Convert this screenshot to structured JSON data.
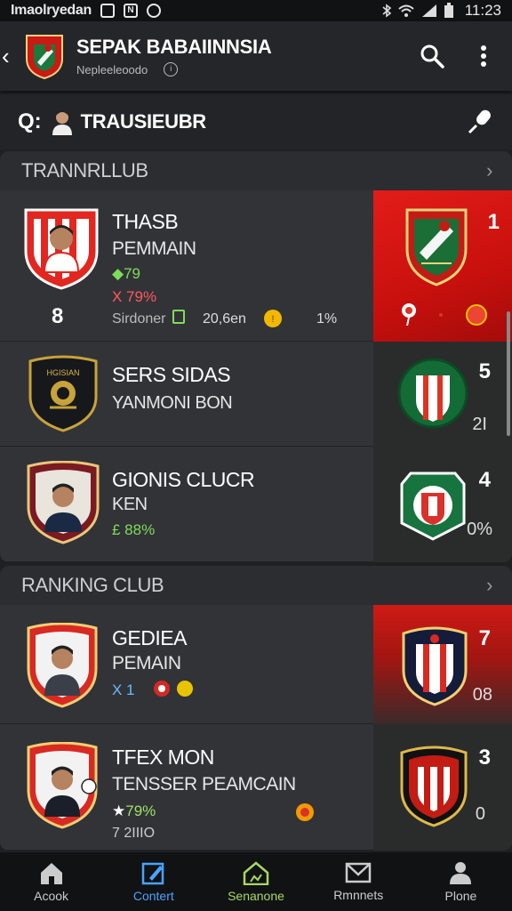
{
  "status": {
    "carrier": "Imaolryedan",
    "icon1": "notification-icon",
    "icon2": "N",
    "icon3": "sync-icon",
    "time": "11:23"
  },
  "appbar": {
    "title": "SEPAK BABAIINNSIA",
    "subtitle": "Nepleeleoodo",
    "back_icon": "back-arrow-icon",
    "search_icon": "search-icon",
    "menu_icon": "more-vertical-icon"
  },
  "search": {
    "prefix": "Q:",
    "text": "TRAUSIEUBR",
    "mic_icon": "microphone-icon"
  },
  "sections": [
    {
      "title": "TRANNRLLUB",
      "cards": [
        {
          "name": "THASB",
          "sub": "PEMMAIN",
          "stat1": "79",
          "stat2": "X 79%",
          "rank_left": "8",
          "info_a": "Sirdoner",
          "info_b": "20,6en",
          "info_c": "1%",
          "rank": "1"
        },
        {
          "name": "SERS SIDAS",
          "sub": "YANMONI BON",
          "rank": "5",
          "extra": "2I"
        },
        {
          "name": "GIONIS CLUCR",
          "sub": "KEN",
          "stat1": "£ 88%",
          "rank": "4",
          "extra": "0%"
        }
      ]
    },
    {
      "title": "RANKING CLUB",
      "cards": [
        {
          "name": "GEDIEA",
          "sub": "PEMAIN",
          "stat1": "X 1",
          "rank": "7",
          "extra": "08"
        },
        {
          "name": "TFEX MON",
          "sub": "TENSSER PEAMCAIN",
          "stat1": "79%",
          "stat2": "7 2IIIO",
          "rank": "3",
          "extra": "0"
        }
      ]
    }
  ],
  "nav": [
    {
      "label": "Acook",
      "icon": "home-icon"
    },
    {
      "label": "Contert",
      "icon": "edit-icon"
    },
    {
      "label": "Senanone",
      "icon": "house-outline-icon"
    },
    {
      "label": "Rmnnets",
      "icon": "mail-icon"
    },
    {
      "label": "Plone",
      "icon": "person-icon"
    }
  ],
  "colors": {
    "red": "#e21d18",
    "green": "#7fdc5a",
    "blue": "#4aa3ff"
  }
}
